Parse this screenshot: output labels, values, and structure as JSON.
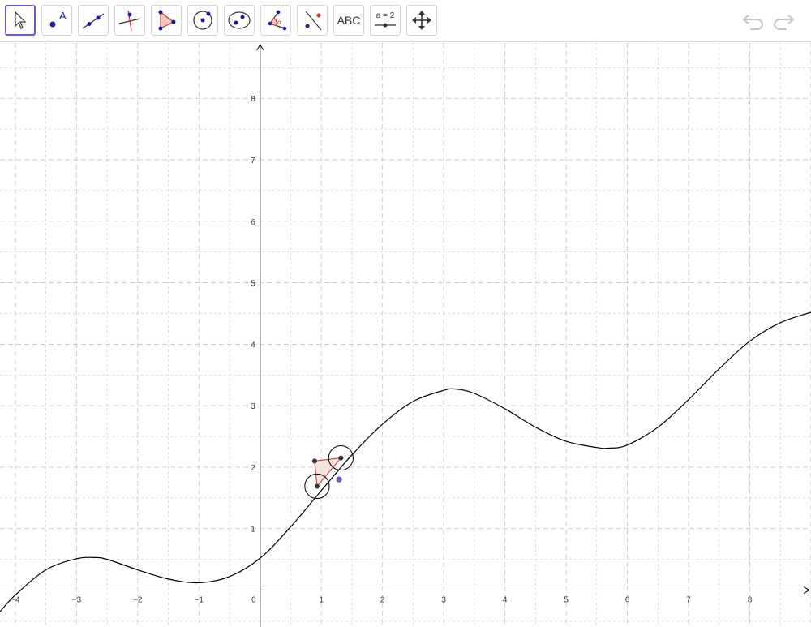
{
  "toolbar": {
    "tools": [
      {
        "name": "move-tool",
        "icon": "cursor-arrow-icon"
      },
      {
        "name": "point-tool",
        "icon": "point-with-label-icon",
        "label": "A"
      },
      {
        "name": "line-tool",
        "icon": "line-through-points-icon"
      },
      {
        "name": "perpendicular-line-tool",
        "icon": "perpendicular-line-icon"
      },
      {
        "name": "polygon-tool",
        "icon": "polygon-icon"
      },
      {
        "name": "circle-center-point-tool",
        "icon": "circle-center-icon"
      },
      {
        "name": "ellipse-tool",
        "icon": "ellipse-icon"
      },
      {
        "name": "angle-tool",
        "icon": "angle-icon",
        "label": "α"
      },
      {
        "name": "reflect-tool",
        "icon": "reflect-about-line-icon"
      },
      {
        "name": "text-tool",
        "icon": "text-icon",
        "label": "ABC"
      },
      {
        "name": "slider-tool",
        "icon": "slider-icon",
        "label": "a = 2"
      },
      {
        "name": "move-graphics-view-tool",
        "icon": "move-view-arrows-icon"
      }
    ],
    "selected_tool": "move-tool",
    "undo_icon": "undo-icon",
    "redo_icon": "redo-icon"
  },
  "chart_data": {
    "type": "line",
    "xlim": [
      -4.25,
      9.0
    ],
    "ylim": [
      -0.6,
      8.9
    ],
    "x_ticks": [
      "-4",
      "-3",
      "-2",
      "-1",
      "0",
      "1",
      "2",
      "3",
      "4",
      "5",
      "6",
      "7",
      "8"
    ],
    "y_ticks": [
      "1",
      "2",
      "3",
      "4",
      "5",
      "6",
      "7",
      "8"
    ],
    "grid": true,
    "series": [
      {
        "x": [
          -4.25,
          -4.0,
          -3.5,
          -3.0,
          -2.7,
          -2.5,
          -2.0,
          -1.5,
          -1.0,
          -0.5,
          0.0,
          0.5,
          1.0,
          1.5,
          2.0,
          2.5,
          3.0,
          3.2,
          3.5,
          4.0,
          4.5,
          5.0,
          5.5,
          5.7,
          6.0,
          6.5,
          7.0,
          7.5,
          8.0,
          8.5,
          9.0
        ],
        "y": [
          -0.35,
          -0.08,
          0.33,
          0.51,
          0.53,
          0.5,
          0.33,
          0.18,
          0.12,
          0.22,
          0.52,
          1.03,
          1.62,
          2.2,
          2.7,
          3.07,
          3.25,
          3.27,
          3.2,
          2.95,
          2.65,
          2.42,
          2.32,
          2.31,
          2.36,
          2.65,
          3.1,
          3.6,
          4.05,
          4.35,
          4.52
        ],
        "color": "#000000"
      }
    ],
    "construction": {
      "polygon_vertices": [
        [
          0.93,
          1.69
        ],
        [
          0.89,
          2.1
        ],
        [
          1.32,
          2.15
        ]
      ],
      "polygon_fill": "#f4dcd6",
      "polygon_stroke": "#c0392b",
      "circles": [
        {
          "center": [
            0.93,
            1.69
          ],
          "radius": 0.2
        },
        {
          "center": [
            1.32,
            2.15
          ],
          "radius": 0.2
        }
      ],
      "curve_point": [
        1.29,
        1.8
      ],
      "curve_point_color": "#6a68c8",
      "vertex_color": "#333333"
    },
    "colors": {
      "grid": "#c8c8c8",
      "axis": "#000000",
      "accent": "#6557d2"
    }
  }
}
